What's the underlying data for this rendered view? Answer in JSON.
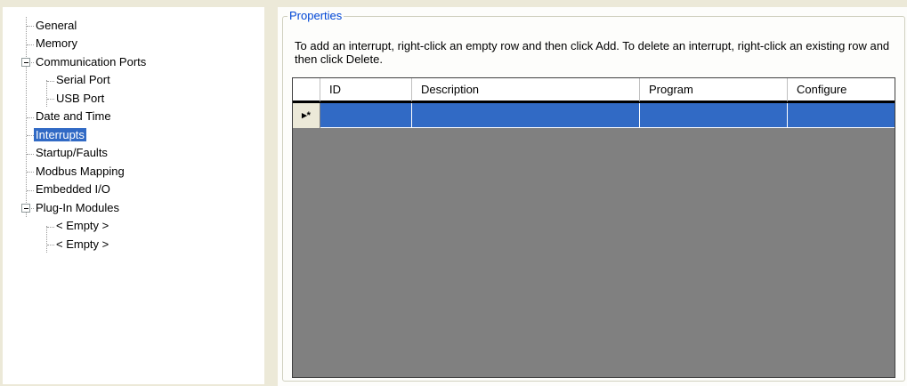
{
  "tree": {
    "items": [
      {
        "label": "General"
      },
      {
        "label": "Memory"
      },
      {
        "label": "Communication Ports"
      },
      {
        "label": "Serial Port"
      },
      {
        "label": "USB Port"
      },
      {
        "label": "Date and Time"
      },
      {
        "label": "Interrupts",
        "selected": true
      },
      {
        "label": "Startup/Faults"
      },
      {
        "label": "Modbus Mapping"
      },
      {
        "label": "Embedded I/O"
      },
      {
        "label": "Plug-In Modules"
      },
      {
        "label": "< Empty >"
      },
      {
        "label": "< Empty >"
      }
    ]
  },
  "properties": {
    "title": "Properties",
    "description": "To add an interrupt, right-click an empty row and then click Add. To delete an interrupt, right-click an existing row and then click Delete.",
    "grid": {
      "columns": [
        "ID",
        "Description",
        "Program",
        "Configure"
      ],
      "new_row_marker": "▸*"
    }
  },
  "colors": {
    "selection": "#316ac5",
    "title": "#0046d5",
    "grid_background": "#808080"
  }
}
